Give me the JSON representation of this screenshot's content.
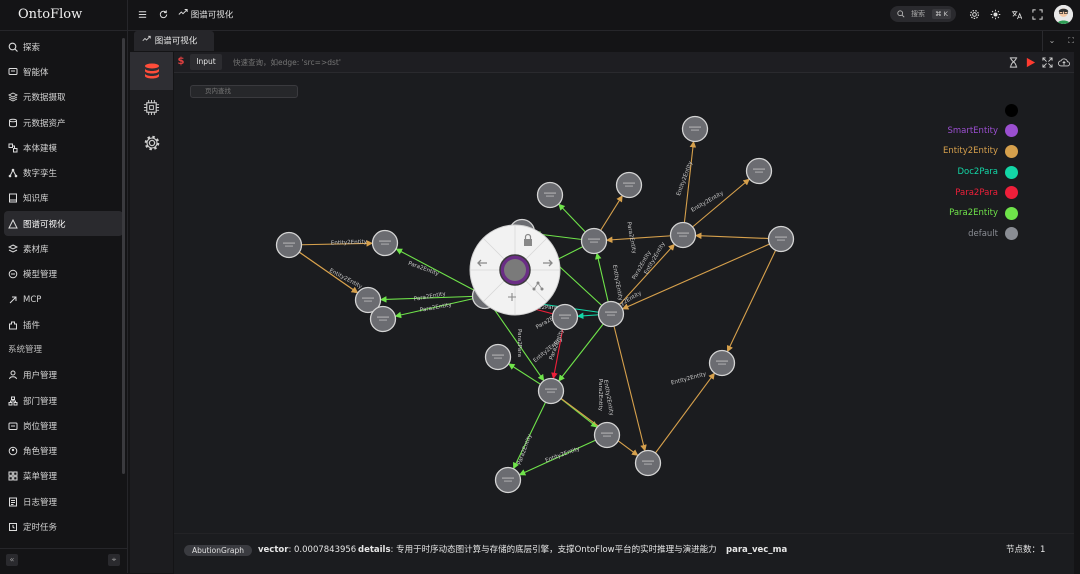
{
  "app": {
    "title": "OntoFlow"
  },
  "sidebar": {
    "items": [
      {
        "label": "探索",
        "icon": "search-icon"
      },
      {
        "label": "智能体",
        "icon": "chat-icon"
      },
      {
        "label": "元数据摄取",
        "icon": "layers-icon"
      },
      {
        "label": "元数据资产",
        "icon": "database-icon"
      },
      {
        "label": "本体建模",
        "icon": "model-icon"
      },
      {
        "label": "数字孪生",
        "icon": "network-icon"
      },
      {
        "label": "知识库",
        "icon": "book-icon"
      },
      {
        "label": "图谱可视化",
        "icon": "graph-icon",
        "active": true
      },
      {
        "label": "素材库",
        "icon": "stack-icon"
      },
      {
        "label": "模型管理",
        "icon": "cube-icon"
      },
      {
        "label": "MCP",
        "icon": "mcp-icon"
      },
      {
        "label": "插件",
        "icon": "plugin-icon"
      }
    ],
    "section": "系统管理",
    "admin_items": [
      {
        "label": "用户管理",
        "icon": "user-icon"
      },
      {
        "label": "部门管理",
        "icon": "org-icon"
      },
      {
        "label": "岗位管理",
        "icon": "post-icon"
      },
      {
        "label": "角色管理",
        "icon": "role-icon"
      },
      {
        "label": "菜单管理",
        "icon": "menu-icon"
      },
      {
        "label": "日志管理",
        "icon": "log-icon"
      },
      {
        "label": "定时任务",
        "icon": "clock-icon"
      }
    ],
    "collapse_glyph": "«",
    "pin_glyph": "⌖"
  },
  "topbar": {
    "breadcrumb": "图谱可视化",
    "search_label": "搜索",
    "search_kbd": "⌘ K"
  },
  "tabs": [
    {
      "label": "图谱可视化"
    }
  ],
  "query": {
    "mode_label": "Input",
    "dollar": "$",
    "placeholder": "快速查询，如edge: 'src=>dst'"
  },
  "canvas": {
    "page_search_placeholder": "页内查找",
    "legend": [
      {
        "label": "",
        "color": "#000000"
      },
      {
        "label": "SmartEntity",
        "color": "#9b4fd0"
      },
      {
        "label": "Entity2Entity",
        "color": "#d6a04c"
      },
      {
        "label": "Doc2Para",
        "color": "#13d6a6"
      },
      {
        "label": "Para2Para",
        "color": "#ee1f3a"
      },
      {
        "label": "Para2Entity",
        "color": "#6fe34a"
      },
      {
        "label": "default",
        "color": "#8a8d94"
      }
    ],
    "edge_labels": [
      "Entity2Entity",
      "Entity2Entity",
      "Para2Entity",
      "Para2Entity",
      "Para2Entity",
      "Para2Entity",
      "Para2Entity",
      "Para2Entity",
      "Doc2Para",
      "Para2Para",
      "Entity2Entity",
      "Entity2Entity",
      "Entity2Entity",
      "Entity2Entity",
      "Entity2Entity",
      "Entity2Entity",
      "Entity2Entity",
      "Para2Entity",
      "Para2Entity",
      "Para2Entity",
      "Entity2Entity",
      "Entity2Entity",
      "Para2Entity"
    ]
  },
  "status": {
    "graph_tag": "AbutionGraph",
    "vector_key": "vector",
    "vector_value": ": 0.0007843956",
    "details_key": "details",
    "details_value": ": 专用于时序动态图计算与存储的底层引擎，支撑OntoFlow平台的实时推理与演进能力",
    "extra_key": "para_vec_ma",
    "node_count_label": "节点数：",
    "node_count": "1"
  }
}
